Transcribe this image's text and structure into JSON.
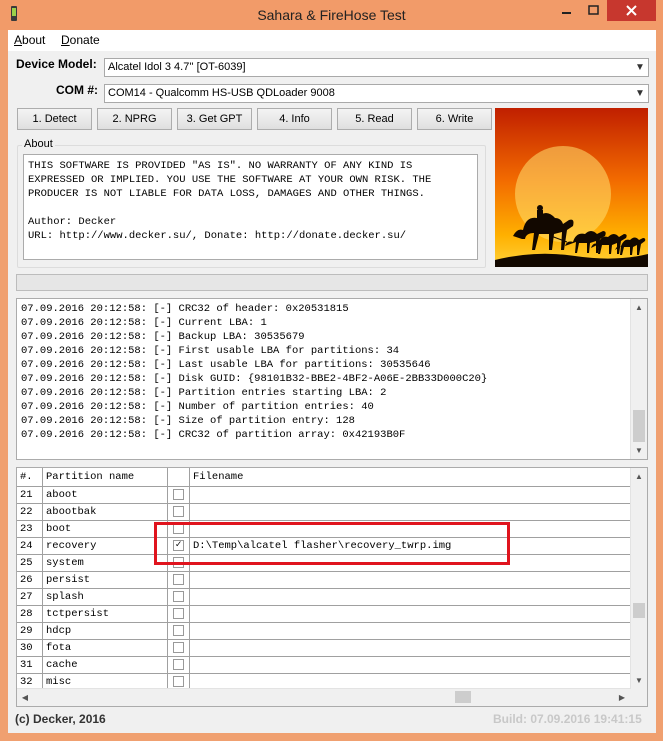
{
  "window": {
    "title": "Sahara & FireHose Test"
  },
  "menu": [
    {
      "label": "About",
      "accel": "A",
      "rest": "bout"
    },
    {
      "label": "Donate",
      "accel": "D",
      "rest": "onate"
    }
  ],
  "device_model": {
    "label": "Device Model:",
    "value": "Alcatel Idol 3 4.7'' [OT-6039]"
  },
  "com_port": {
    "label": "COM #:",
    "value": "COM14 - Qualcomm HS-USB QDLoader 9008"
  },
  "buttons": [
    "1. Detect",
    "2. NPRG",
    "3. Get GPT",
    "4. Info",
    "5. Read",
    "6. Write"
  ],
  "about": {
    "group_title": "About",
    "text": "THIS SOFTWARE IS PROVIDED \"AS IS\". NO WARRANTY OF ANY KIND IS\nEXPRESSED OR IMPLIED. YOU USE THE SOFTWARE AT YOUR OWN RISK. THE\nPRODUCER IS NOT LIABLE FOR DATA LOSS, DAMAGES AND OTHER THINGS.\n\nAuthor: Decker\nURL: http://www.decker.su/, Donate: http://donate.decker.su/"
  },
  "progress": {
    "value": 0
  },
  "log": [
    "07.09.2016 20:12:58: [-] CRC32 of header: 0x20531815",
    "07.09.2016 20:12:58: [-] Current LBA: 1",
    "07.09.2016 20:12:58: [-] Backup LBA: 30535679",
    "07.09.2016 20:12:58: [-] First usable LBA for partitions: 34",
    "07.09.2016 20:12:58: [-] Last usable LBA for partitions: 30535646",
    "07.09.2016 20:12:58: [-] Disk GUID: {98101B32-BBE2-4BF2-A06E-2BB33D000C20}",
    "07.09.2016 20:12:58: [-] Partition entries starting LBA: 2",
    "07.09.2016 20:12:58: [-] Number of partition entries: 40",
    "07.09.2016 20:12:58: [-] Size of partition entry: 128",
    "07.09.2016 20:12:58: [-] CRC32 of partition array: 0x42193B0F"
  ],
  "table": {
    "headers": {
      "num": "#.",
      "name": "Partition name",
      "check": "",
      "file": "Filename"
    },
    "rows": [
      {
        "num": "21",
        "name": "aboot",
        "checked": false,
        "file": ""
      },
      {
        "num": "22",
        "name": "abootbak",
        "checked": false,
        "file": ""
      },
      {
        "num": "23",
        "name": "boot",
        "checked": false,
        "file": ""
      },
      {
        "num": "24",
        "name": "recovery",
        "checked": true,
        "file": "D:\\Temp\\alcatel flasher\\recovery_twrp.img"
      },
      {
        "num": "25",
        "name": "system",
        "checked": false,
        "file": ""
      },
      {
        "num": "26",
        "name": "persist",
        "checked": false,
        "file": ""
      },
      {
        "num": "27",
        "name": "splash",
        "checked": false,
        "file": ""
      },
      {
        "num": "28",
        "name": "tctpersist",
        "checked": false,
        "file": ""
      },
      {
        "num": "29",
        "name": "hdcp",
        "checked": false,
        "file": ""
      },
      {
        "num": "30",
        "name": "fota",
        "checked": false,
        "file": ""
      },
      {
        "num": "31",
        "name": "cache",
        "checked": false,
        "file": ""
      },
      {
        "num": "32",
        "name": "misc",
        "checked": false,
        "file": ""
      }
    ]
  },
  "status": {
    "left": "(c) Decker, 2016",
    "right": "Build: 07.09.2016 19:41:15"
  },
  "colors": {
    "titlebar": "#f29b69",
    "close": "#c7372e",
    "highlight": "#e0141e"
  },
  "icons": [
    "app-icon",
    "minimize-icon",
    "maximize-icon",
    "close-icon",
    "chevron-down-icon",
    "scroll-up-icon",
    "scroll-down-icon",
    "scroll-left-icon",
    "scroll-right-icon",
    "checkmark-icon"
  ]
}
